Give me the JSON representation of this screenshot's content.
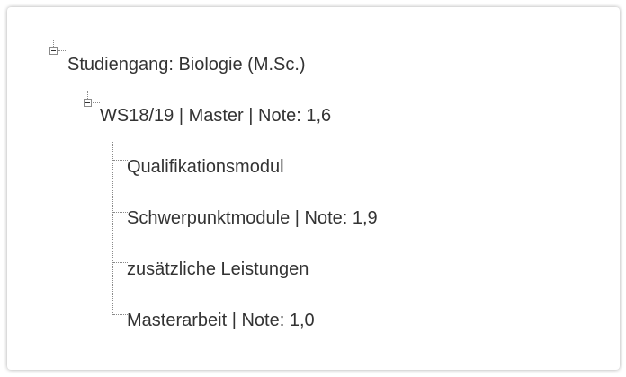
{
  "tree": {
    "root": {
      "label": "Studiengang: Biologie (M.Sc.)",
      "expanded": true,
      "children": [
        {
          "label": "WS18/19 | Master | Note: 1,6",
          "expanded": true,
          "children": [
            {
              "label": "Qualifikationsmodul"
            },
            {
              "label": "Schwerpunktmodule | Note: 1,9"
            },
            {
              "label": "zusätzliche Leistungen"
            },
            {
              "label": "Masterarbeit | Note: 1,0"
            }
          ]
        }
      ]
    }
  },
  "colors": {
    "text": "#333333",
    "connector": "#8a8a8a",
    "background": "#ffffff"
  },
  "icons": {
    "expanded_toggle": "collapse-minus-icon"
  }
}
